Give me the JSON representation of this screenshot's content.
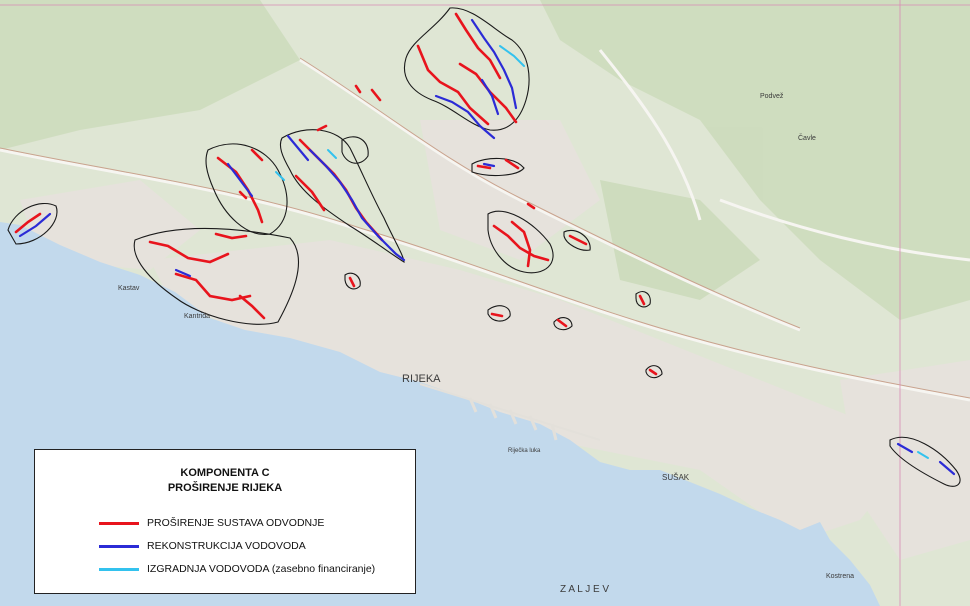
{
  "map": {
    "colors": {
      "sea": "#c2d9ec",
      "land": "#dfe6d4",
      "urban": "#e9e6e2",
      "forest": "#cfdcbf",
      "road": "#f4f4f2",
      "sewer": "#e8141d",
      "water_reconstruction": "#2b2bd6",
      "water_new": "#33c2ee",
      "zone_outline": "#1a1a1a"
    },
    "place_labels": {
      "rijeka": "RIJEKA",
      "susak": "SUŠAK",
      "kastav": "Kastav",
      "kantrida": "Kantrida",
      "cavle": "Čavle",
      "podvezica": "Podvež",
      "kostrena": "Kostrena",
      "zaljev": "Z A L J E V",
      "luka": "Riječka luka"
    }
  },
  "legend": {
    "title_line1": "KOMPONENTA C",
    "title_line2": "PROŠIRENJE RIJEKA",
    "items": [
      {
        "label": "PROŠIRENJE SUSTAVA ODVODNJE",
        "color": "#e8141d"
      },
      {
        "label": "REKONSTRUKCIJA VODOVODA",
        "color": "#2b2bd6"
      },
      {
        "label": "IZGRADNJA VODOVODA (zasebno financiranje)",
        "color": "#33c2ee"
      }
    ]
  }
}
